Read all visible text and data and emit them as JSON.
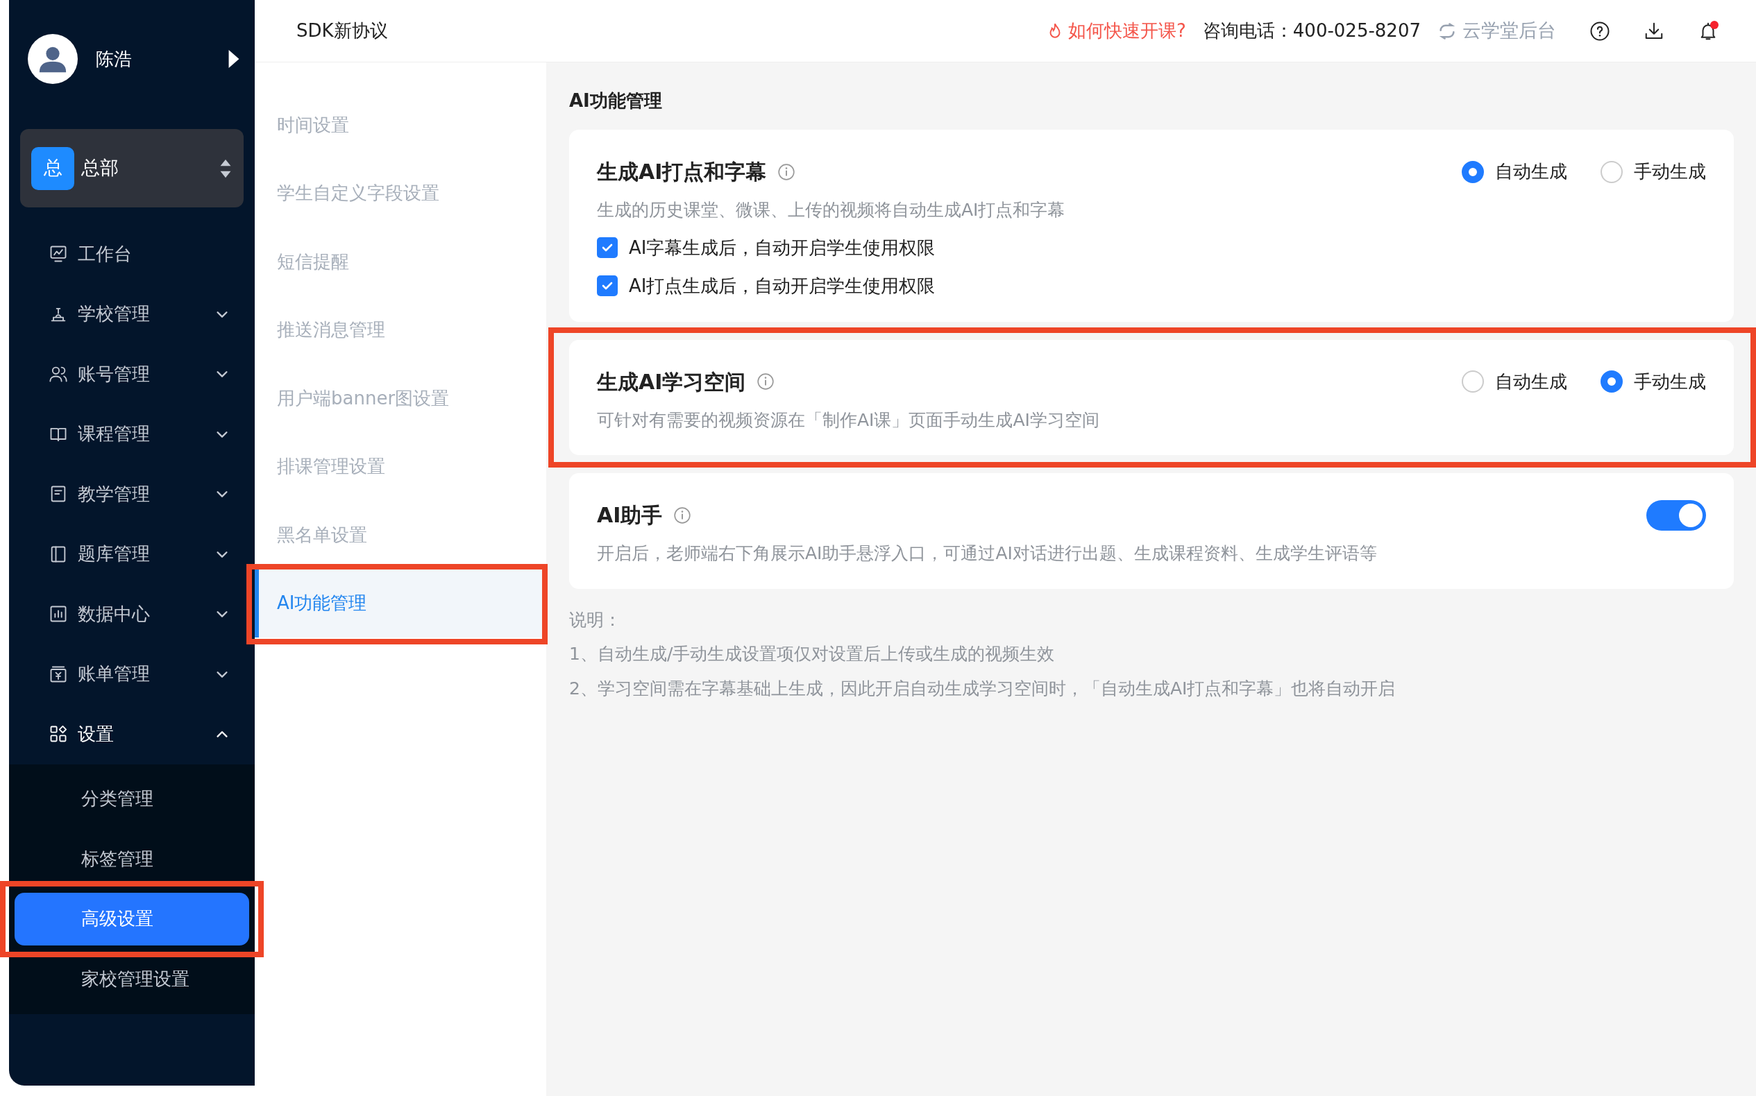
{
  "user": {
    "name": "陈浩"
  },
  "org": {
    "badge": "总",
    "name": "总部"
  },
  "nav": [
    {
      "label": "工作台",
      "kind": "link",
      "expanded": false
    },
    {
      "label": "学校管理",
      "kind": "group",
      "expanded": false
    },
    {
      "label": "账号管理",
      "kind": "group",
      "expanded": false
    },
    {
      "label": "课程管理",
      "kind": "group",
      "expanded": false
    },
    {
      "label": "教学管理",
      "kind": "group",
      "expanded": false
    },
    {
      "label": "题库管理",
      "kind": "group",
      "expanded": false
    },
    {
      "label": "数据中心",
      "kind": "group",
      "expanded": false
    },
    {
      "label": "账单管理",
      "kind": "group",
      "expanded": false
    },
    {
      "label": "设置",
      "kind": "group",
      "expanded": true,
      "children": [
        {
          "label": "分类管理",
          "selected": false,
          "highlighted": false
        },
        {
          "label": "标签管理",
          "selected": false,
          "highlighted": false
        },
        {
          "label": "高级设置",
          "selected": true,
          "highlighted": true
        },
        {
          "label": "家校管理设置",
          "selected": false,
          "highlighted": false
        }
      ]
    }
  ],
  "header": {
    "title": "SDK新协议",
    "help_link": "如何快速开课?",
    "phone": "咨询电话：400-025-8207",
    "switch_link": "云学堂后台",
    "notification_dot": true
  },
  "settings_menu": [
    {
      "label": "时间设置",
      "selected": false,
      "highlighted": false
    },
    {
      "label": "学生自定义字段设置",
      "selected": false,
      "highlighted": false
    },
    {
      "label": "短信提醒",
      "selected": false,
      "highlighted": false
    },
    {
      "label": "推送消息管理",
      "selected": false,
      "highlighted": false
    },
    {
      "label": "用户端banner图设置",
      "selected": false,
      "highlighted": false
    },
    {
      "label": "排课管理设置",
      "selected": false,
      "highlighted": false
    },
    {
      "label": "黑名单设置",
      "selected": false,
      "highlighted": false
    },
    {
      "label": "AI功能管理",
      "selected": true,
      "highlighted": true
    }
  ],
  "page_title": "AI功能管理",
  "cards": [
    {
      "kind": "radio",
      "title": "生成AI打点和字幕",
      "description": "生成的历史课堂、微课、上传的视频将自动生成AI打点和字幕",
      "highlighted": false,
      "options": [
        {
          "label": "自动生成",
          "selected": true
        },
        {
          "label": "手动生成",
          "selected": false
        }
      ],
      "checkboxes": [
        {
          "label": "AI字幕生成后，自动开启学生使用权限",
          "checked": true
        },
        {
          "label": "AI打点生成后，自动开启学生使用权限",
          "checked": true
        }
      ]
    },
    {
      "kind": "radio",
      "title": "生成AI学习空间",
      "description": "可针对有需要的视频资源在「制作AI课」页面手动生成AI学习空间",
      "highlighted": true,
      "options": [
        {
          "label": "自动生成",
          "selected": false
        },
        {
          "label": "手动生成",
          "selected": true
        }
      ]
    },
    {
      "kind": "toggle",
      "title": "AI助手",
      "description": "开启后，老师端右下角展示AI助手悬浮入口，可通过AI对话进行出题、生成课程资料、生成学生评语等",
      "highlighted": false,
      "on": true
    }
  ],
  "notes": [
    "说明：",
    "1、自动生成/手动生成设置项仅对设置后上传或生成的视频生效",
    "2、学习空间需在字幕基础上生成，因此开启自动生成学习空间时，「自动生成AI打点和字幕」也将自动开启"
  ]
}
